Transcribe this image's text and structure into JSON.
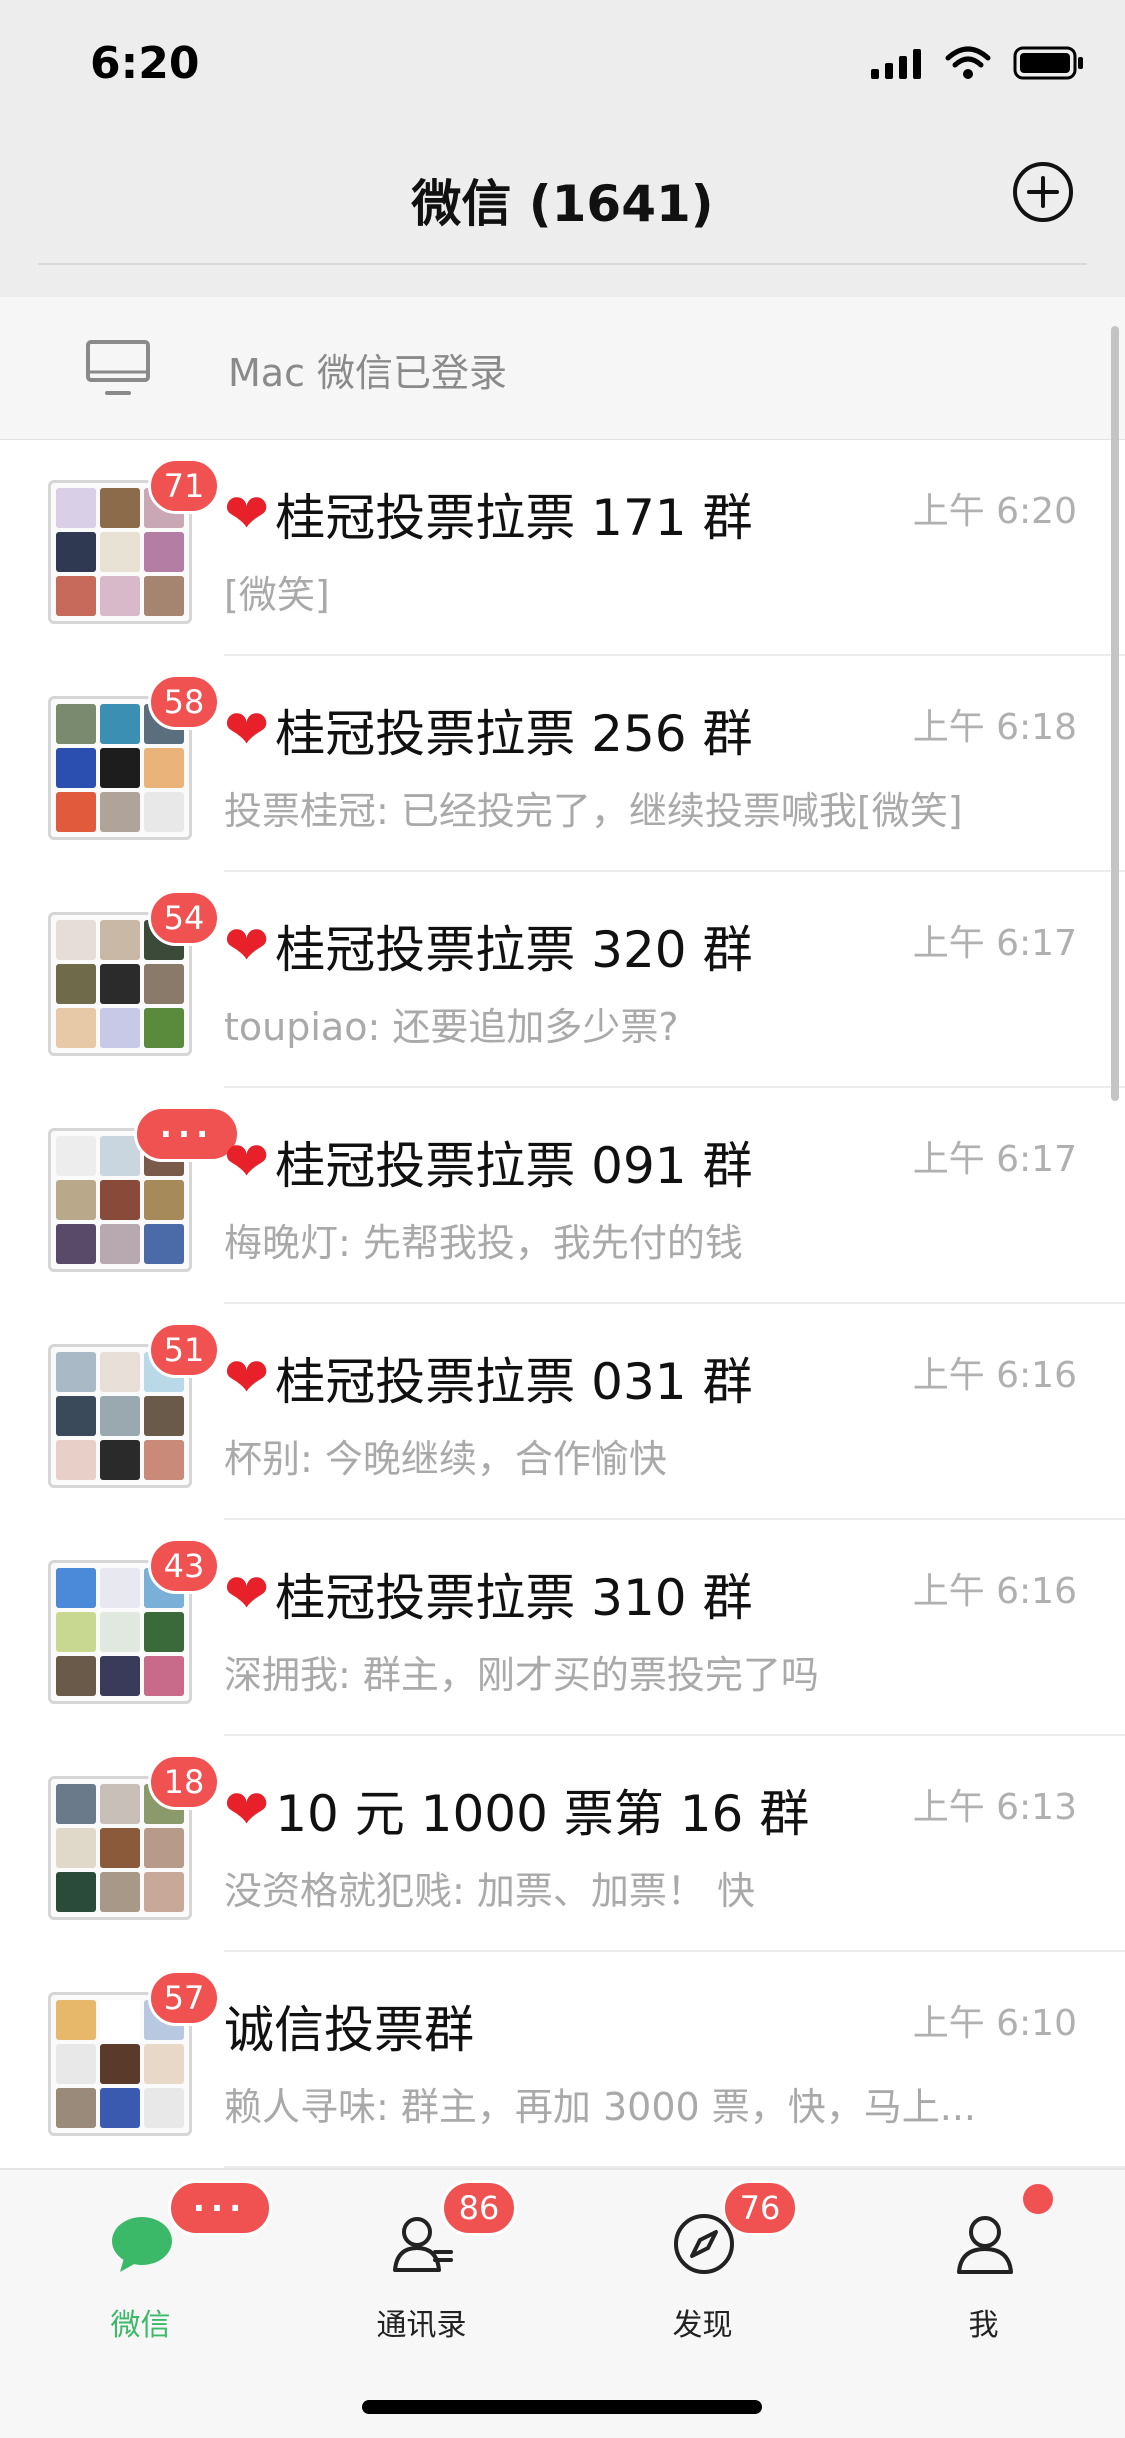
{
  "status_bar": {
    "time": "6:20"
  },
  "header": {
    "title": "微信 (1641)"
  },
  "banner": {
    "text": "Mac 微信已登录",
    "icon": "monitor-icon"
  },
  "chats": [
    {
      "title": "桂冠投票拉票 171 群",
      "heart": true,
      "time": "上午 6:20",
      "preview": "[微笑]",
      "badge": "71",
      "tiles": [
        "#d9d0e8",
        "#8b6b4a",
        "#c9a7b5",
        "#2f3a52",
        "#e8e2d4",
        "#b47ea4",
        "#c76a5b",
        "#d8b9c9",
        "#a58470"
      ]
    },
    {
      "title": "桂冠投票拉票 256 群",
      "heart": true,
      "time": "上午 6:18",
      "preview": "投票桂冠: 已经投完了，继续投票喊我[微笑]",
      "badge": "58",
      "tiles": [
        "#7a8a6e",
        "#3b8fb3",
        "#5b6e7d",
        "#2a4fb0",
        "#1d1d1d",
        "#e9b37a",
        "#e15a3b",
        "#b0a39a",
        "#e8e8e8"
      ]
    },
    {
      "title": "桂冠投票拉票 320 群",
      "heart": true,
      "time": "上午 6:17",
      "preview": "toupiao: 还要追加多少票?",
      "badge": "54",
      "tiles": [
        "#e6dcd8",
        "#c9b8a6",
        "#3c4a3a",
        "#6e6a4a",
        "#2b2b2b",
        "#8a7a6a",
        "#e8c9a7",
        "#c8c9e6",
        "#5a8a3b"
      ]
    },
    {
      "title": "桂冠投票拉票 091 群",
      "heart": true,
      "time": "上午 6:17",
      "preview": "梅晚灯: 先帮我投，我先付的钱",
      "badge": "···",
      "tiles": [
        "#ededed",
        "#c9d6e0",
        "#7a5a4a",
        "#b9a98a",
        "#8a4a3a",
        "#a68a5a",
        "#5a4a6a",
        "#b8a8b0",
        "#4a6aa8"
      ]
    },
    {
      "title": "桂冠投票拉票 031 群",
      "heart": true,
      "time": "上午 6:16",
      "preview": "杯别: 今晚继续，合作愉快",
      "badge": "51",
      "tiles": [
        "#a9bac6",
        "#e8e0d8",
        "#b9d8e8",
        "#3a4a5a",
        "#9aa8b0",
        "#6a5a4a",
        "#e8d0c8",
        "#2a2a2a",
        "#c98a7a"
      ]
    },
    {
      "title": "桂冠投票拉票 310 群",
      "heart": true,
      "time": "上午 6:16",
      "preview": "深拥我: 群主，刚才买的票投完了吗",
      "badge": "43",
      "tiles": [
        "#4a8ad8",
        "#e8e8f0",
        "#7ab0d8",
        "#c8d890",
        "#e0e8e0",
        "#3a6a3a",
        "#6a5a4a",
        "#3a3a5a",
        "#c86a8a"
      ]
    },
    {
      "title": "10 元 1000 票第 16 群",
      "heart": true,
      "time": "上午 6:13",
      "preview": "没资格就犯贱: 加票、加票！ 快",
      "badge": "18",
      "tiles": [
        "#6a7a8a",
        "#c8c0b8",
        "#8a9a6a",
        "#e0d8c8",
        "#8a5a3a",
        "#b89a8a",
        "#2a4a3a",
        "#a89888",
        "#c8a898"
      ]
    },
    {
      "title": "诚信投票群",
      "heart": false,
      "time": "上午 6:10",
      "preview": "赖人寻味: 群主，再加 3000 票，快，马上...",
      "badge": "57",
      "tiles": [
        "#e8b86a",
        "#ffffff",
        "#b8c8e0",
        "#e8e8e8",
        "#5a3a2a",
        "#e8d8c8",
        "#9a8a7a",
        "#3a5ab0",
        "#e8e8e8"
      ]
    }
  ],
  "tabs": [
    {
      "label": "微信",
      "icon": "chat-icon",
      "badge": "···",
      "active": true
    },
    {
      "label": "通讯录",
      "icon": "contacts-icon",
      "badge": "86",
      "active": false
    },
    {
      "label": "发现",
      "icon": "compass-icon",
      "badge": "76",
      "active": false
    },
    {
      "label": "我",
      "icon": "person-icon",
      "badge": "",
      "dot": true,
      "active": false
    }
  ],
  "colors": {
    "accent": "#3cb968",
    "badge": "#f05151",
    "heart": "#e7202a"
  }
}
